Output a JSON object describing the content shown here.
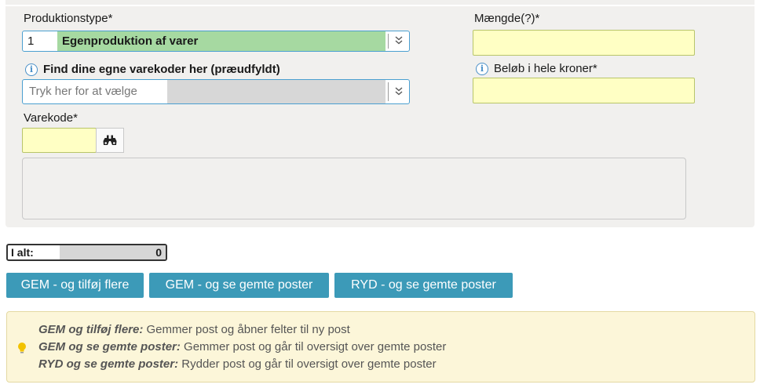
{
  "form": {
    "production_type": {
      "label": "Produktionstype*",
      "number": "1",
      "value": "Egenproduktion af varer"
    },
    "item_codes": {
      "label": "Find dine egne varekoder her (præudfyldt)",
      "placeholder": "Tryk her for at vælge"
    },
    "item_code": {
      "label": "Varekode*",
      "value": ""
    },
    "quantity": {
      "label": "Mængde(?)*",
      "value": ""
    },
    "amount": {
      "label": "Beløb i hele kroner*",
      "value": ""
    }
  },
  "total": {
    "label": "I alt:",
    "value": "0"
  },
  "buttons": {
    "save_add": "GEM - og tilføj flere",
    "save_view": "GEM - og se gemte poster",
    "clear_view": "RYD - og se gemte poster"
  },
  "help": {
    "line1_title": "GEM og tilføj flere:",
    "line1_text": " Gemmer post og åbner felter til ny post",
    "line2_title": "GEM og se gemte poster:",
    "line2_text": " Gemmer post og går til oversigt over gemte poster",
    "line3_title": "RYD og se gemte poster:",
    "line3_text": " Rydder post og går til oversigt over gemte poster"
  },
  "icons": {
    "info": "info-icon",
    "chevron": "chevron-double-down-icon",
    "search": "binoculars-icon",
    "tip": "lightbulb-icon"
  },
  "colors": {
    "accent_button": "#3c9ab8",
    "selected_green": "#a6d9a1",
    "required_yellow": "#ffffc4",
    "info_box": "#fcf6d9"
  }
}
